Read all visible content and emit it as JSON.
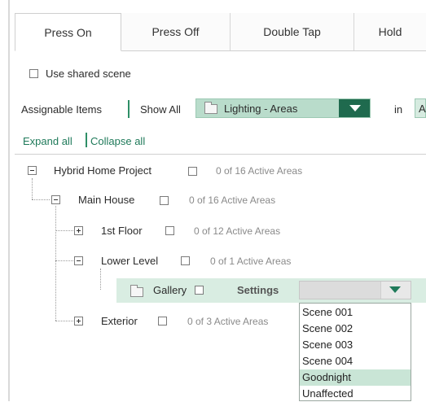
{
  "tabs": [
    {
      "label": "Press On",
      "active": true
    },
    {
      "label": "Press Off",
      "active": false
    },
    {
      "label": "Double Tap",
      "active": false
    },
    {
      "label": "Hold",
      "active": false
    }
  ],
  "shared_scene": {
    "label": "Use shared scene",
    "checked": false
  },
  "filter_bar": {
    "assignable_label": "Assignable Items",
    "show_all_label": "Show All",
    "category_value": "Lighting - Areas",
    "in_label": "in",
    "in_value_partial": "A"
  },
  "tree_controls": {
    "expand_all": "Expand all",
    "collapse_all": "Collapse all"
  },
  "tree": {
    "project": {
      "label": "Hybrid Home Project",
      "status": "0 of 16 Active Areas"
    },
    "main_house": {
      "label": "Main House",
      "status": "0 of 16 Active Areas"
    },
    "first_floor": {
      "label": "1st Floor",
      "status": "0 of 12 Active Areas"
    },
    "lower_level": {
      "label": "Lower Level",
      "status": "0 of 1 Active Areas"
    },
    "gallery": {
      "label": "Gallery",
      "settings_label": "Settings",
      "selected_value": ""
    },
    "exterior": {
      "label": "Exterior",
      "status": "0 of 3 Active Areas"
    }
  },
  "settings_options": [
    "Scene 001",
    "Scene 002",
    "Scene 003",
    "Scene 004",
    "Goodnight",
    "Unaffected"
  ],
  "highlighted_option": "Goodnight",
  "colors": {
    "accent": "#1f6a4e",
    "accent_light": "#b9dccb",
    "row_highlight": "#d9ede2"
  }
}
